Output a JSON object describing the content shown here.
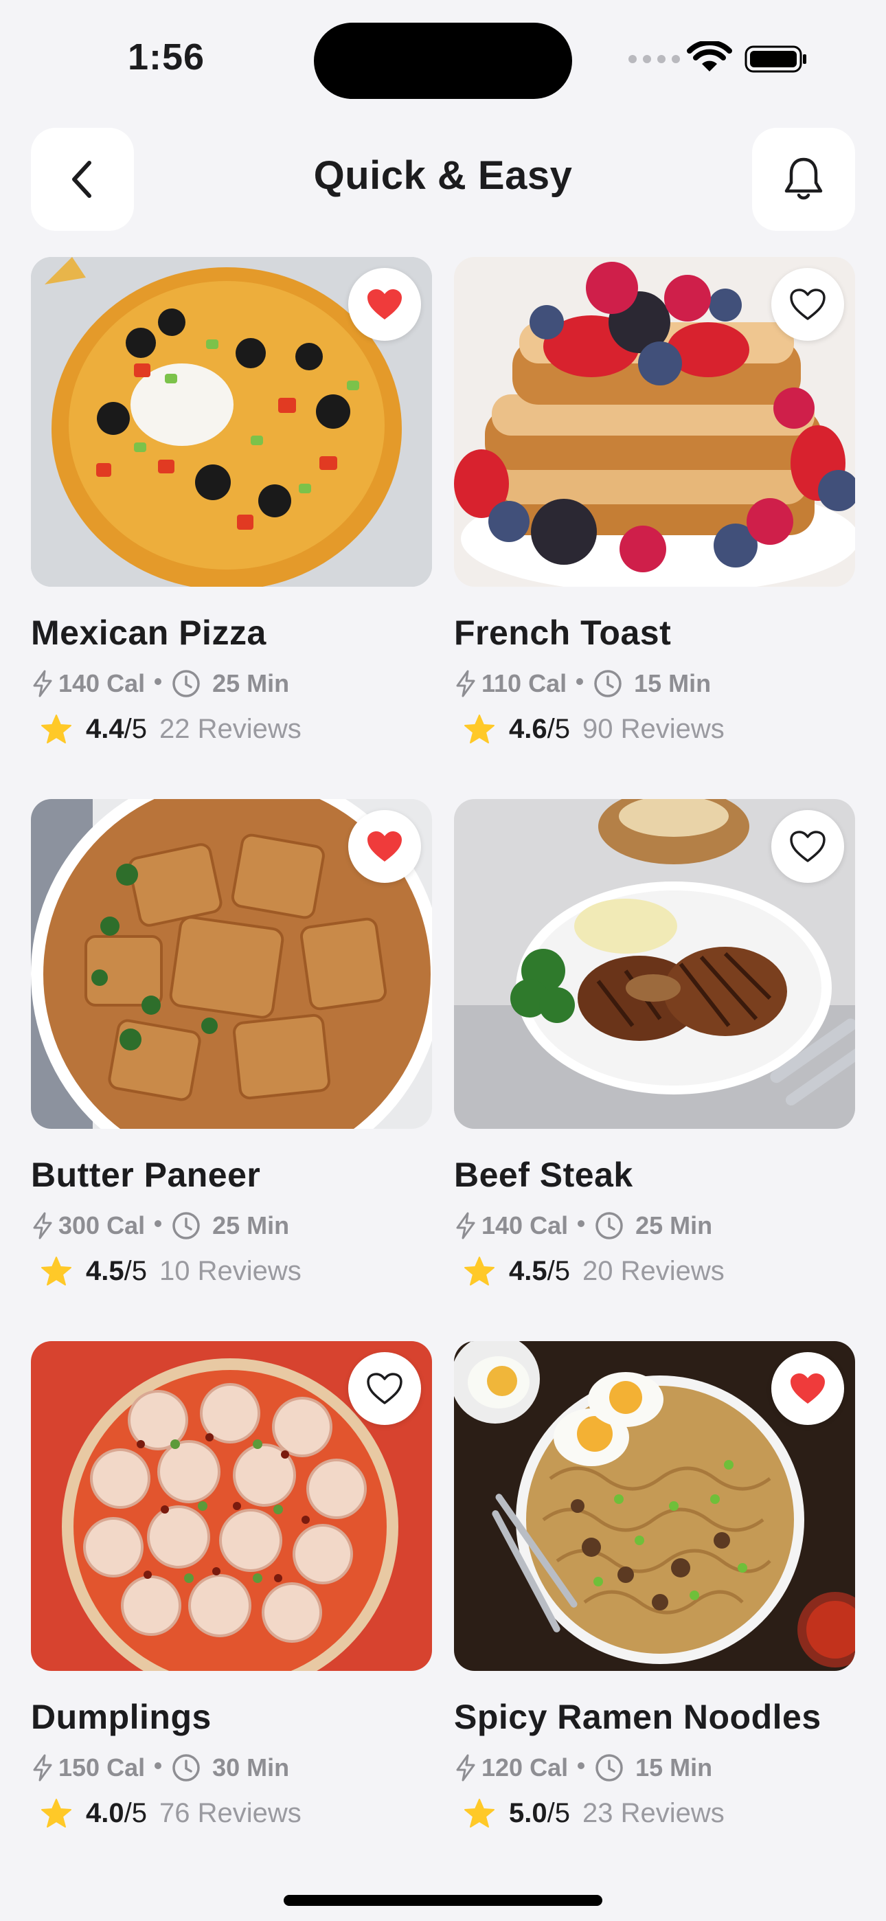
{
  "status_bar": {
    "time": "1:56"
  },
  "header": {
    "title": "Quick & Easy",
    "back_icon": "chevron-left-icon",
    "bell_icon": "bell-icon"
  },
  "colors": {
    "background": "#F4F4F7",
    "favorite_active": "#EF3B3B",
    "star": "#FFC928",
    "muted_text": "#8E8E93"
  },
  "recipes": [
    {
      "name": "Mexican Pizza",
      "calories": "140 Cal",
      "time": "25 Min",
      "score": "4.4",
      "out_of": "/5",
      "reviews": "22 Reviews",
      "favorite": true
    },
    {
      "name": "French Toast",
      "calories": "110 Cal",
      "time": "15 Min",
      "score": "4.6",
      "out_of": "/5",
      "reviews": "90 Reviews",
      "favorite": false
    },
    {
      "name": "Butter Paneer",
      "calories": "300 Cal",
      "time": "25 Min",
      "score": "4.5",
      "out_of": "/5",
      "reviews": "10 Reviews",
      "favorite": true
    },
    {
      "name": "Beef Steak",
      "calories": "140 Cal",
      "time": "25 Min",
      "score": "4.5",
      "out_of": "/5",
      "reviews": "20 Reviews",
      "favorite": false
    },
    {
      "name": "Dumplings",
      "calories": "150 Cal",
      "time": "30 Min",
      "score": "4.0",
      "out_of": "/5",
      "reviews": "76 Reviews",
      "favorite": false
    },
    {
      "name": "Spicy Ramen Noodles",
      "calories": "120 Cal",
      "time": "15 Min",
      "score": "5.0",
      "out_of": "/5",
      "reviews": "23 Reviews",
      "favorite": true
    }
  ]
}
